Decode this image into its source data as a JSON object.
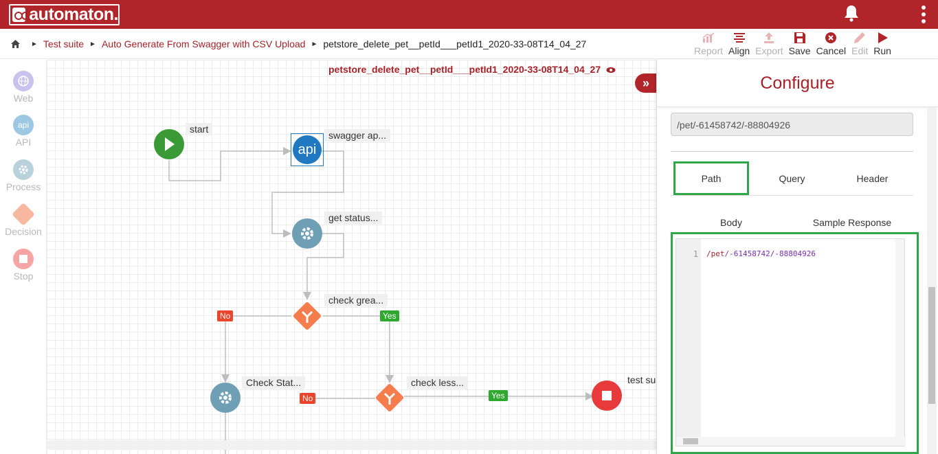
{
  "app": {
    "brand": "automaton."
  },
  "breadcrumb": {
    "items": [
      "Test suite",
      "Auto Generate From Swagger with CSV Upload"
    ],
    "current": "petstore_delete_pet__petId___petId1_2020-33-08T14_04_27"
  },
  "toolbar": {
    "report": "Report",
    "align": "Align",
    "export": "Export",
    "save": "Save",
    "cancel": "Cancel",
    "edit": "Edit",
    "run": "Run"
  },
  "palette": {
    "web": "Web",
    "web_icon": "globe-icon",
    "api": "API",
    "api_icon_text": "api",
    "process": "Process",
    "decision": "Decision",
    "stop": "Stop"
  },
  "canvas": {
    "title": "petstore_delete_pet__petId___petId1_2020-33-08T14_04_27",
    "nodes": {
      "start": "start",
      "swagger": "swagger ap...",
      "api_icon": "api",
      "get_status": "get status...",
      "check_greater": "check grea...",
      "check_status": "Check Stat...",
      "check_less": "check less...",
      "test_success": "test su"
    },
    "badges": {
      "no": "No",
      "yes": "Yes"
    }
  },
  "colors": {
    "brand": "#b0242a",
    "start": "#3a9a35",
    "api": "#1f78c0",
    "process": "#6f9fb5",
    "decision": "#f57c4d",
    "stop": "#e83a3a",
    "highlight": "#2fa64a"
  },
  "panel": {
    "title": "Configure",
    "endpoint": "/pet/-61458742/-88804926",
    "tabs": [
      "Path",
      "Query",
      "Header"
    ],
    "active_tab": "Path",
    "subtabs": [
      "Body",
      "Sample Response"
    ],
    "editor": {
      "line_number": "1",
      "seg1": "/pet",
      "seg2": "/-61458742",
      "seg3": "/-88804926"
    }
  }
}
